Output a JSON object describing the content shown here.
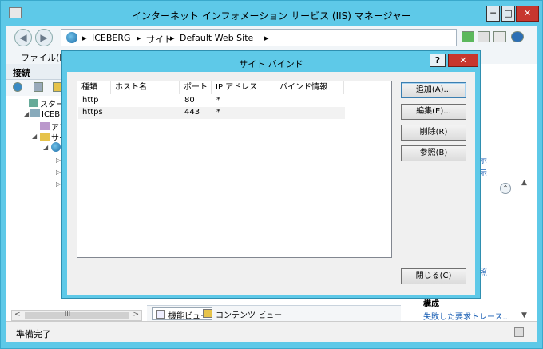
{
  "window": {
    "title": "インターネット インフォメーション サービス (IIS) マネージャー",
    "min_label": "─",
    "max_label": "□",
    "close_label": "✕"
  },
  "address": {
    "crumbs": [
      "ICEBERG",
      "サイト",
      "Default Web Site"
    ],
    "separator": "▸"
  },
  "menu": {
    "file": "ファイル(F)"
  },
  "connections": {
    "title": "接続",
    "tree": [
      {
        "label": "スタート"
      },
      {
        "label": "ICEBERG"
      },
      {
        "label": "アプリ"
      },
      {
        "label": "サイト"
      }
    ]
  },
  "bottom_tabs": {
    "features_view": "機能ビュー",
    "content_view": "コンテンツ ビュー"
  },
  "actions": {
    "link1_frag": "示",
    "link2_frag": "示",
    "link3_frag": "照",
    "config_heading": "構成",
    "failed_request_tracing": "失敗した要求トレース..."
  },
  "status": {
    "text": "準備完了"
  },
  "dialog": {
    "title": "サイト バインド",
    "help_label": "?",
    "close_label": "✕",
    "columns": [
      "種類",
      "ホスト名",
      "ポート",
      "IP アドレス",
      "バインド情報"
    ],
    "rows": [
      {
        "type": "http",
        "host": "",
        "port": "80",
        "ip": "*",
        "info": ""
      },
      {
        "type": "https",
        "host": "",
        "port": "443",
        "ip": "*",
        "info": ""
      }
    ],
    "buttons": {
      "add": "追加(A)...",
      "edit": "編集(E)...",
      "remove": "削除(R)",
      "browse": "参照(B)",
      "close": "閉じる(C)"
    }
  },
  "scrollbar": {
    "left": "<",
    "right": ">",
    "grip": "III",
    "up": "▲",
    "down": "▼"
  }
}
